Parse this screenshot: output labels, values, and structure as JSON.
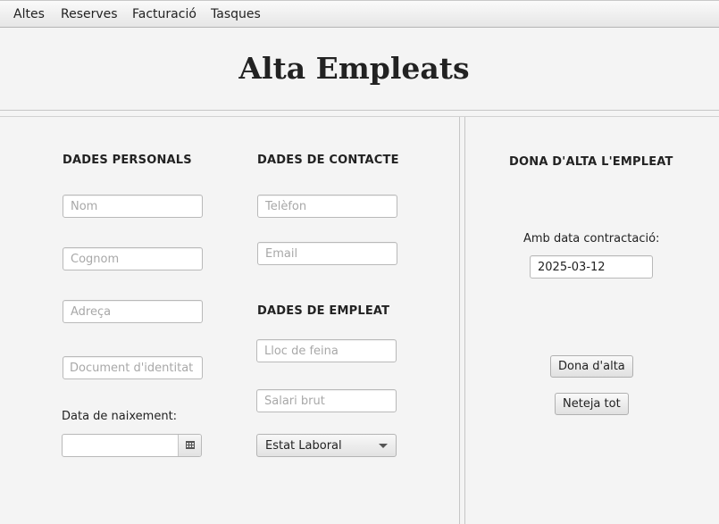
{
  "menu": {
    "items": [
      {
        "label": "Altes"
      },
      {
        "label": "Reserves"
      },
      {
        "label": "Facturació"
      },
      {
        "label": "Tasques"
      }
    ]
  },
  "header": {
    "title": "Alta Empleats"
  },
  "personal": {
    "title": "DADES PERSONALS",
    "nom_placeholder": "Nom",
    "cognom_placeholder": "Cognom",
    "adreca_placeholder": "Adreça",
    "document_placeholder": "Document d'identitat",
    "birth_label": "Data de naixement:",
    "birth_value": "",
    "calendar_icon": "calendar-icon"
  },
  "contact": {
    "title": "DADES DE CONTACTE",
    "telefon_placeholder": "Telèfon",
    "email_placeholder": "Email"
  },
  "employee": {
    "title": "DADES DE EMPLEAT",
    "lloc_placeholder": "Lloc de feina",
    "salari_placeholder": "Salari brut",
    "estat_selected": "Estat Laboral"
  },
  "register": {
    "title": "DONA D'ALTA L'EMPLEAT",
    "hire_date_label": "Amb data contractació:",
    "hire_date_value": "2025-03-12",
    "submit_label": "Dona d'alta",
    "clear_label": "Neteja tot"
  }
}
